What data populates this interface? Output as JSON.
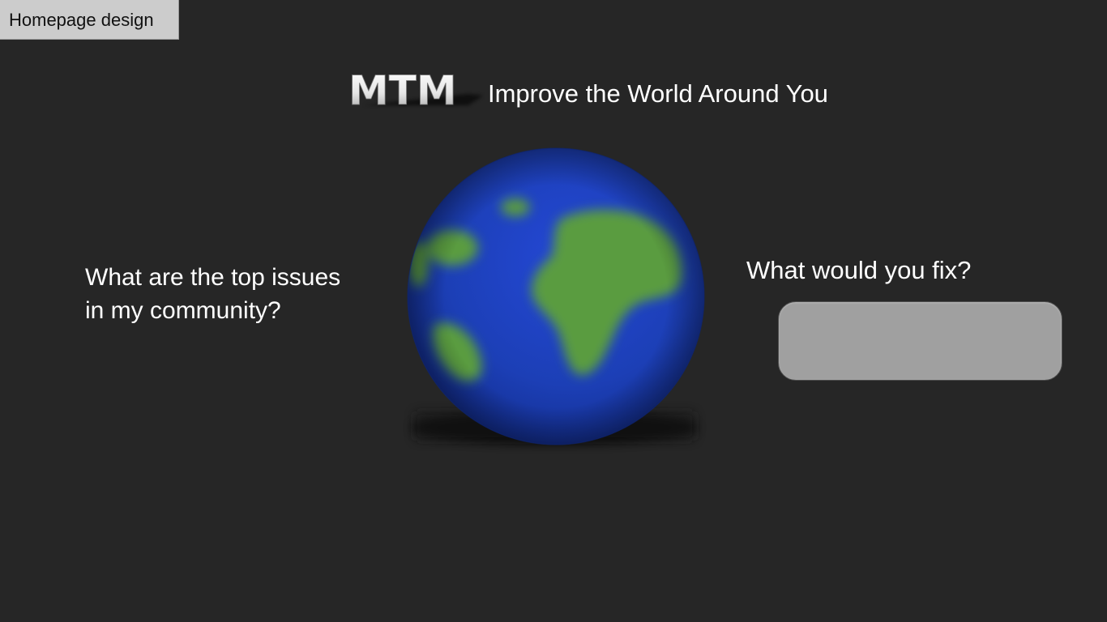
{
  "tab": {
    "label": "Homepage design"
  },
  "header": {
    "logo_text": "MTM",
    "tagline": "Improve the World Around You"
  },
  "main": {
    "left_question": {
      "line1": "What are the top issues",
      "line2": "in my community?"
    },
    "right_question": "What would you fix?",
    "fix_input": {
      "value": "",
      "placeholder": ""
    },
    "globe_icon": "earth-globe-icon"
  },
  "colors": {
    "background": "#262626",
    "ocean": "#1d3fb8",
    "land": "#5a9c3f",
    "input_fill": "#a0a0a0",
    "text": "#ffffff"
  }
}
